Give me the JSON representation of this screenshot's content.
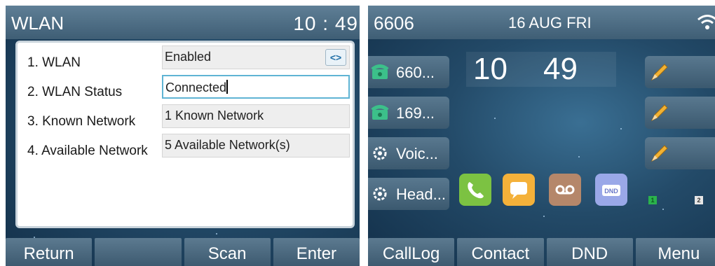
{
  "left": {
    "title": "WLAN",
    "time": "10 : 49",
    "rows": [
      {
        "label": "1. WLAN",
        "value": "Enabled"
      },
      {
        "label": "2. WLAN Status",
        "value": "Connected"
      },
      {
        "label": "3. Known Network",
        "value": "1 Known Network"
      },
      {
        "label": "4. Available Network",
        "value": "5 Available Network(s)"
      }
    ],
    "switch_glyph": "<>",
    "softkeys": [
      "Return",
      "",
      "Scan",
      "Enter"
    ]
  },
  "right": {
    "extension": "6606",
    "date": "16 AUG FRI",
    "clock_hour": "10",
    "clock_minute": "49",
    "linekeys": [
      {
        "label": "660...",
        "icon": "phone-icon"
      },
      {
        "label": "169...",
        "icon": "phone-icon"
      },
      {
        "label": "Voic...",
        "icon": "voicemail-icon"
      },
      {
        "label": "Head...",
        "icon": "headset-icon"
      }
    ],
    "apps": [
      {
        "name": "phone-app-icon",
        "color": "#7cc242"
      },
      {
        "name": "message-app-icon",
        "color": "#f4b13a"
      },
      {
        "name": "voicemail-app-icon",
        "color": "#b5876a"
      },
      {
        "name": "dnd-app-icon",
        "color": "#9aa8e8",
        "text": "DND"
      }
    ],
    "pages": [
      "1",
      "2"
    ],
    "softkeys": [
      "CallLog",
      "Contact",
      "DND",
      "Menu"
    ]
  },
  "colors": {
    "accent": "#5fb4d4",
    "softkey": "#4a687e",
    "background": "#234a68"
  }
}
